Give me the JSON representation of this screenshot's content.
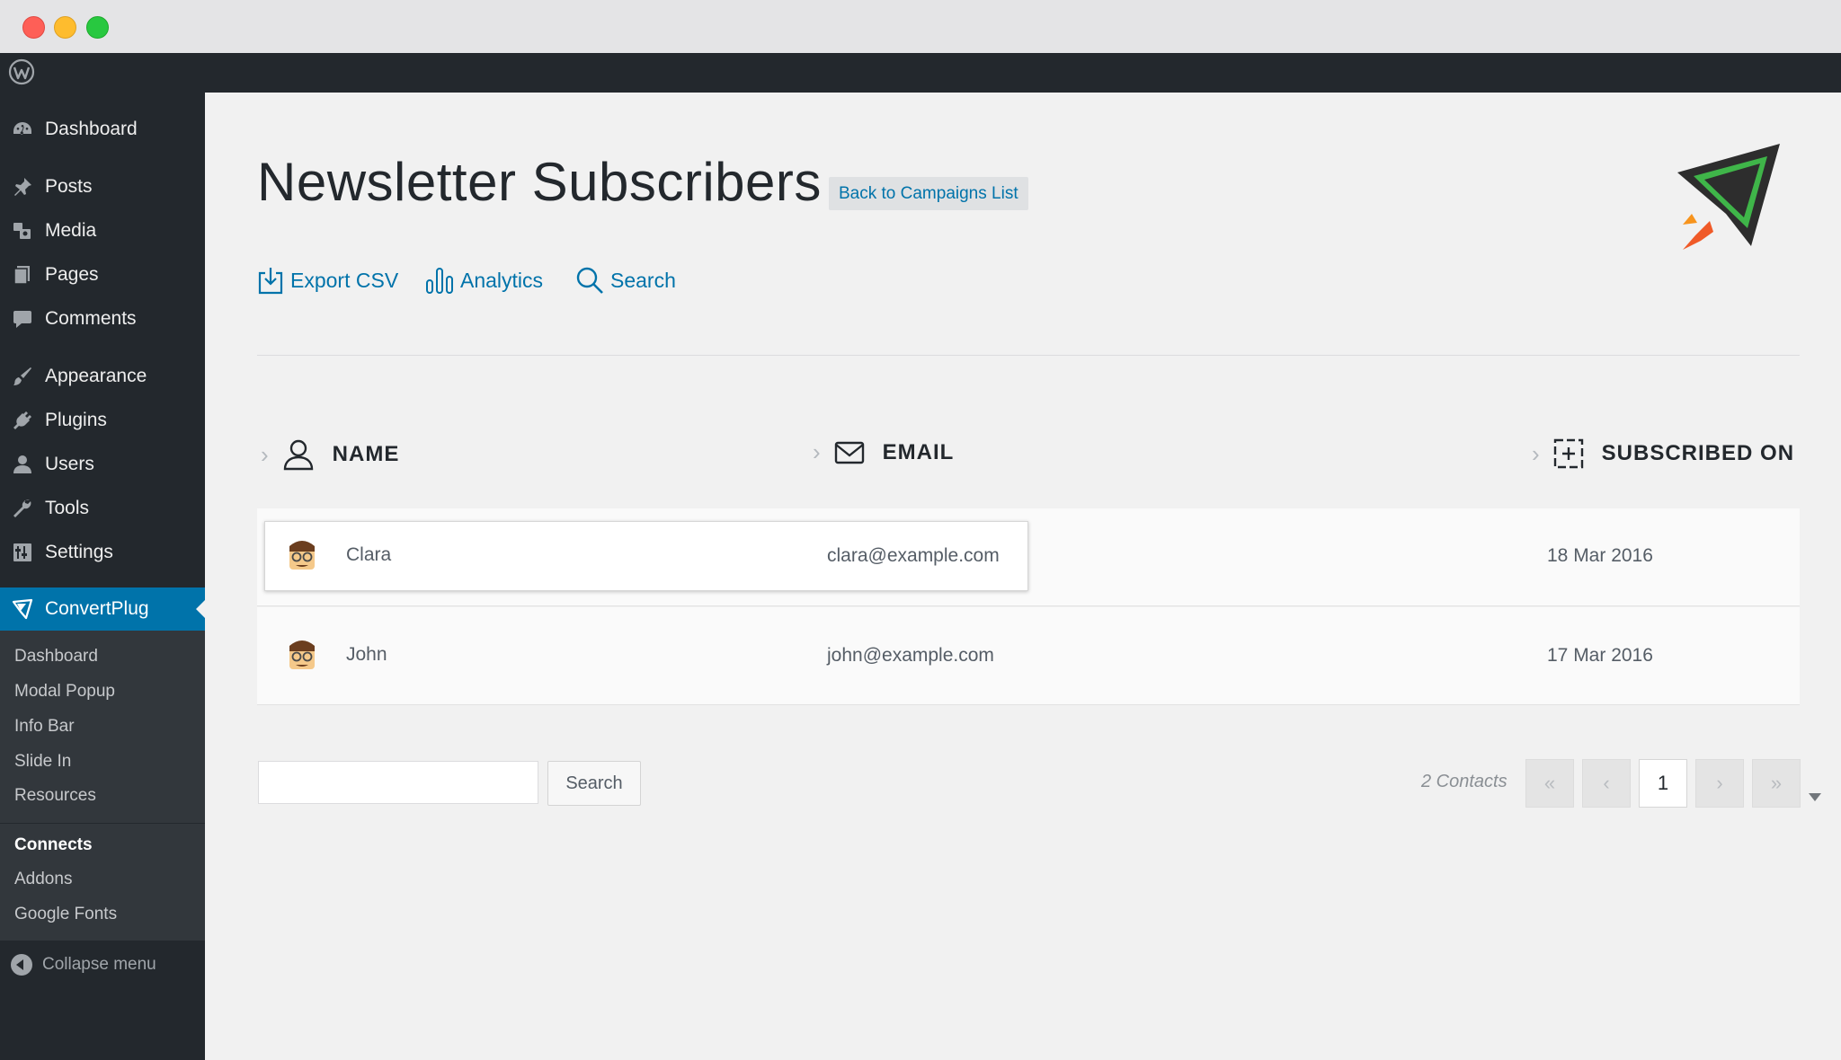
{
  "admin_menu": {
    "items": [
      {
        "label": "Dashboard",
        "icon": "dashboard-icon"
      },
      {
        "label": "Posts",
        "icon": "pin-icon"
      },
      {
        "label": "Media",
        "icon": "media-icon"
      },
      {
        "label": "Pages",
        "icon": "pages-icon"
      },
      {
        "label": "Comments",
        "icon": "comment-icon"
      },
      {
        "label": "Appearance",
        "icon": "brush-icon"
      },
      {
        "label": "Plugins",
        "icon": "plug-icon"
      },
      {
        "label": "Users",
        "icon": "user-icon"
      },
      {
        "label": "Tools",
        "icon": "wrench-icon"
      },
      {
        "label": "Settings",
        "icon": "settings-icon"
      },
      {
        "label": "ConvertPlug",
        "icon": "convertplug-icon"
      }
    ],
    "submenu": [
      "Dashboard",
      "Modal Popup",
      "Info Bar",
      "Slide In",
      "Resources",
      "Connects",
      "Addons",
      "Google Fonts"
    ],
    "current_submenu": "Connects",
    "collapse_label": "Collapse menu"
  },
  "page": {
    "title": "Newsletter Subscribers",
    "back_button": "Back to Campaigns List"
  },
  "actions": {
    "export": "Export CSV",
    "analytics": "Analytics",
    "search": "Search"
  },
  "table": {
    "columns": [
      "NAME",
      "EMAIL",
      "SUBSCRIBED ON"
    ],
    "rows": [
      {
        "name": "Clara",
        "email": "clara@example.com",
        "date": "18 Mar 2016"
      },
      {
        "name": "John",
        "email": "john@example.com",
        "date": "17 Mar 2016"
      }
    ]
  },
  "footer": {
    "search_button": "Search",
    "search_value": "",
    "count": "2 Contacts",
    "page": "1",
    "first": "«",
    "prev": "‹",
    "next": "›",
    "last": "»"
  },
  "colors": {
    "accent": "#0073aa",
    "sidebar": "#23282d",
    "submenu": "#32373c"
  }
}
